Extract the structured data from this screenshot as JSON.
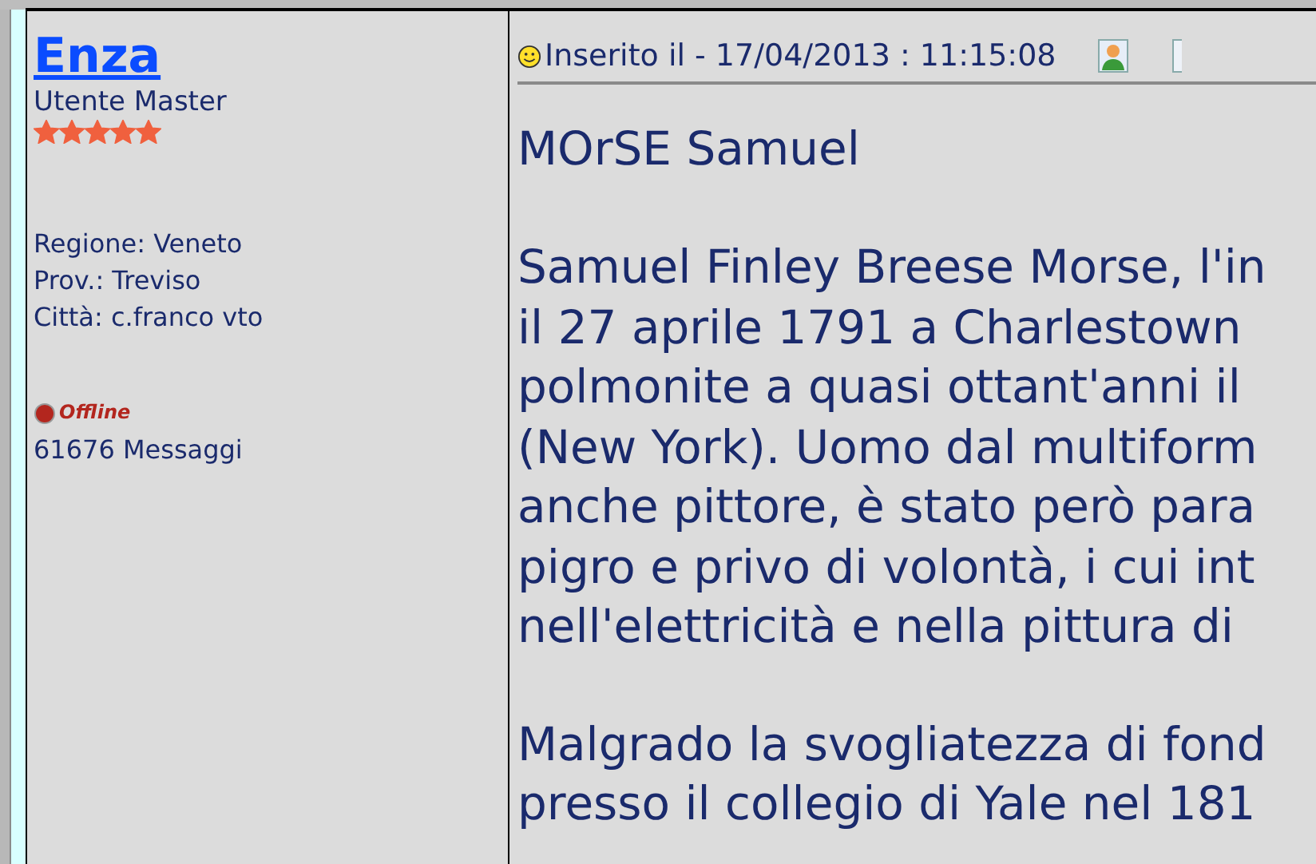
{
  "author": {
    "name": "Enza",
    "rank": "Utente Master",
    "stars": 5,
    "location": [
      "Regione: Veneto",
      "Prov.: Treviso",
      "Città: c.franco vto"
    ],
    "status": "Offline",
    "online": false,
    "posts": "61676 Messaggi"
  },
  "post": {
    "posted": "Inserito il - 17/04/2013 : 11:15:08",
    "title": "MOrSE Samuel",
    "paragraphs": [
      [
        "Samuel Finley Breese Morse, l'in",
        "il 27 aprile 1791 a Charlestown",
        "polmonite a quasi ottant'anni il",
        "(New York). Uomo dal multiform",
        "anche pittore, è stato però para",
        "pigro e privo di volontà, i cui int",
        "nell'elettricità e nella pittura di"
      ],
      [
        "Malgrado la svogliatezza di fond",
        "presso il collegio di Yale nel 181"
      ]
    ]
  }
}
